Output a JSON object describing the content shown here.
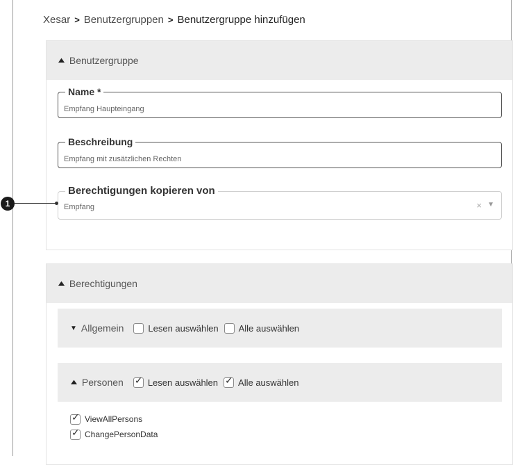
{
  "breadcrumb": {
    "items": [
      "Xesar",
      "Benutzergruppen"
    ],
    "current": "Benutzergruppe hinzufügen",
    "separator": ">"
  },
  "usergroup_panel": {
    "title": "Benutzergruppe",
    "name_field": {
      "label": "Name *",
      "value": "Empfang Haupteingang"
    },
    "description_field": {
      "label": "Beschreibung",
      "value": "Empfang mit zusätzlichen Rechten"
    },
    "copy_field": {
      "label": "Berechtigungen kopieren von",
      "value": "Empfang",
      "clear_symbol": "×",
      "dropdown_symbol": "▼"
    }
  },
  "permissions_panel": {
    "title": "Berechtigungen",
    "groups": [
      {
        "title": "Allgemein",
        "expanded": false,
        "read_label": "Lesen auswählen",
        "read_checked": false,
        "all_label": "Alle auswählen",
        "all_checked": false
      },
      {
        "title": "Personen",
        "expanded": true,
        "read_label": "Lesen auswählen",
        "read_checked": true,
        "all_label": "Alle auswählen",
        "all_checked": true,
        "items": [
          {
            "label": "ViewAllPersons",
            "checked": true
          },
          {
            "label": "ChangePersonData",
            "checked": true
          }
        ]
      }
    ]
  },
  "callout": {
    "number": "1"
  },
  "icons": {
    "expanded": "chevron-up-icon",
    "collapsed": "chevron-down-icon"
  }
}
